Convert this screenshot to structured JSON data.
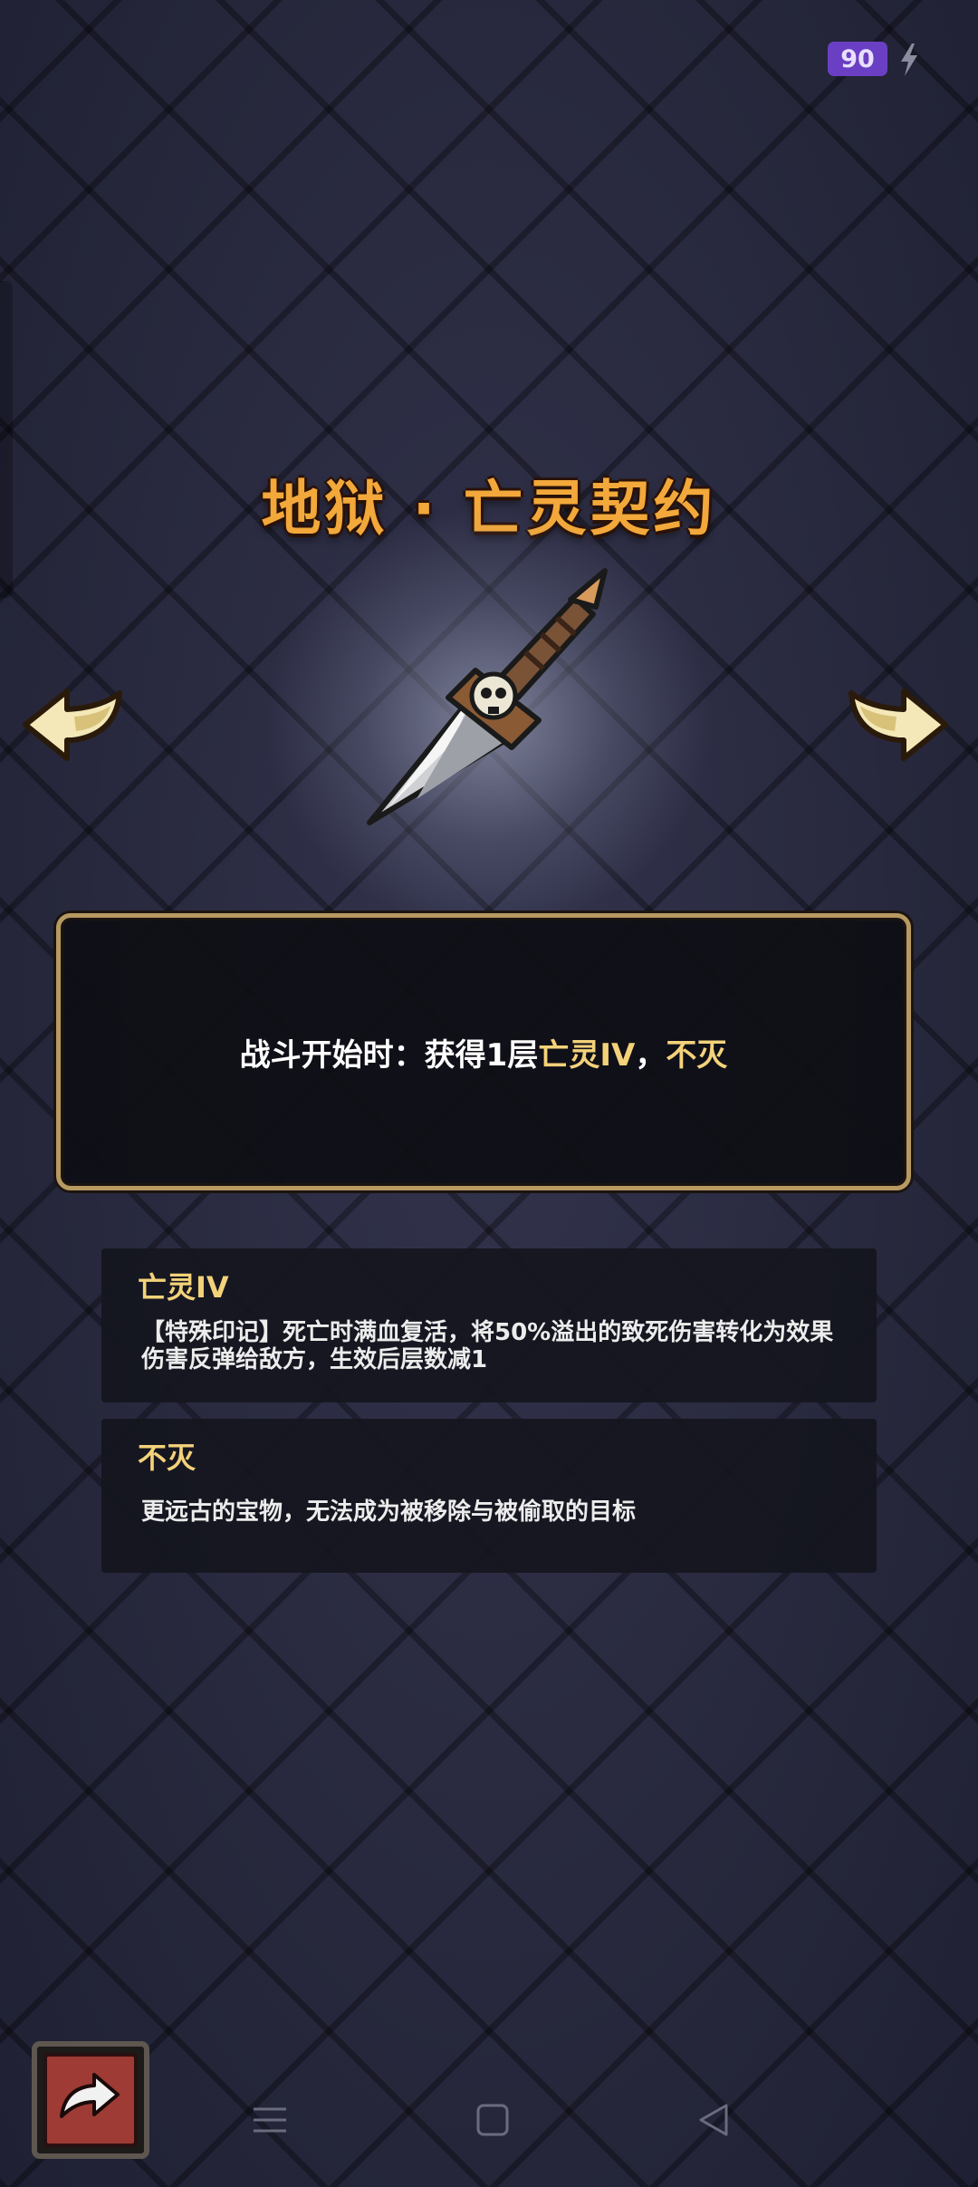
{
  "status": {
    "battery_level": "90"
  },
  "artifact": {
    "title": "地狱 · 亡灵契约",
    "effect": {
      "prefix": "战斗开始时：获得1层",
      "keyword1": "亡灵IV",
      "separator": "，",
      "keyword2": "不灭"
    }
  },
  "keywords": [
    {
      "name": "亡灵IV",
      "description": "【特殊印记】死亡时满血复活，将50%溢出的致死伤害转化为效果伤害反弹给敌方，生效后层数减1"
    },
    {
      "name": "不灭",
      "description": "更远古的宝物，无法成为被移除与被偷取的目标"
    }
  ],
  "colors": {
    "title": "#f2a83a",
    "keyword": "#f3d27a",
    "frame": "#b79a62",
    "back_button": "#9e3b34"
  },
  "icons": [
    "lightning-icon",
    "dagger-skull-icon",
    "arrow-left-icon",
    "arrow-right-icon",
    "return-icon",
    "menu-icon",
    "home-icon",
    "back-triangle-icon"
  ]
}
